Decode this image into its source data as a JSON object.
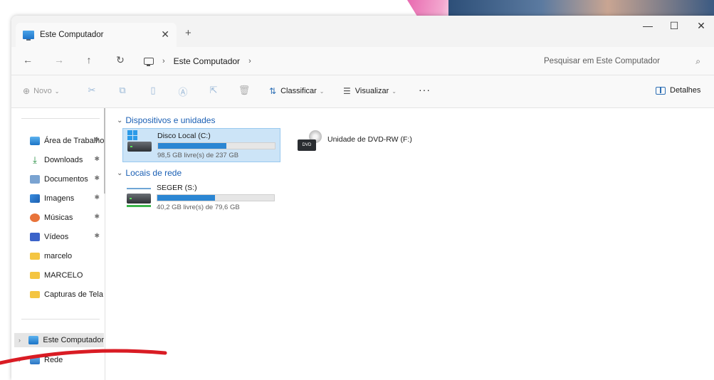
{
  "window": {
    "tab_title": "Este Computador",
    "tab_close": "✕",
    "new_tab": "+",
    "minimize": "—",
    "maximize": "☐",
    "close": "✕"
  },
  "nav": {
    "back": "←",
    "forward": "→",
    "up": "↑",
    "refresh": "↻",
    "breadcrumb_sep": "›",
    "breadcrumb": [
      "Este Computador"
    ],
    "search_placeholder": "Pesquisar em Este Computador",
    "search_icon": "⌕"
  },
  "commands": {
    "new_label": "Novo",
    "sort_label": "Classificar",
    "view_label": "Visualizar",
    "more_label": "···",
    "details_label": "Detalhes"
  },
  "sidebar": {
    "quick_access": [
      {
        "label": "Área de Trabalho",
        "icon": "desktop-icon",
        "pinned": true
      },
      {
        "label": "Downloads",
        "icon": "download-icon",
        "pinned": true
      },
      {
        "label": "Documentos",
        "icon": "documents-icon",
        "pinned": true
      },
      {
        "label": "Imagens",
        "icon": "pictures-icon",
        "pinned": true
      },
      {
        "label": "Músicas",
        "icon": "music-icon",
        "pinned": true
      },
      {
        "label": "Vídeos",
        "icon": "videos-icon",
        "pinned": true
      },
      {
        "label": "marcelo",
        "icon": "folder-icon",
        "pinned": false
      },
      {
        "label": "MARCELO",
        "icon": "folder-icon",
        "pinned": false
      },
      {
        "label": "Capturas de Tela",
        "icon": "folder-icon",
        "pinned": false
      }
    ],
    "tree": [
      {
        "label": "Este Computador",
        "icon": "pc-icon",
        "selected": true
      },
      {
        "label": "Rede",
        "icon": "network-icon",
        "selected": false
      }
    ],
    "pin_glyph": "✱",
    "expand_glyph": "›"
  },
  "content": {
    "group_devices": "Dispositivos e unidades",
    "group_network": "Locais de rede",
    "drives": [
      {
        "name": "Disco Local (C:)",
        "free_text": "98,5 GB livre(s) de 237 GB",
        "used_fraction": 0.584,
        "selected": true
      },
      {
        "name": "Unidade de DVD-RW (F:)",
        "dvd_label": "DVD"
      }
    ],
    "network_drives": [
      {
        "name": "SEGER (S:)",
        "free_text": "40,2 GB livre(s) de 79,6 GB",
        "used_fraction": 0.495
      }
    ]
  },
  "colors": {
    "accent": "#2b86d3",
    "selection": "#cce4f7",
    "group_header": "#1a5fb4",
    "annotation": "#d91c24"
  }
}
